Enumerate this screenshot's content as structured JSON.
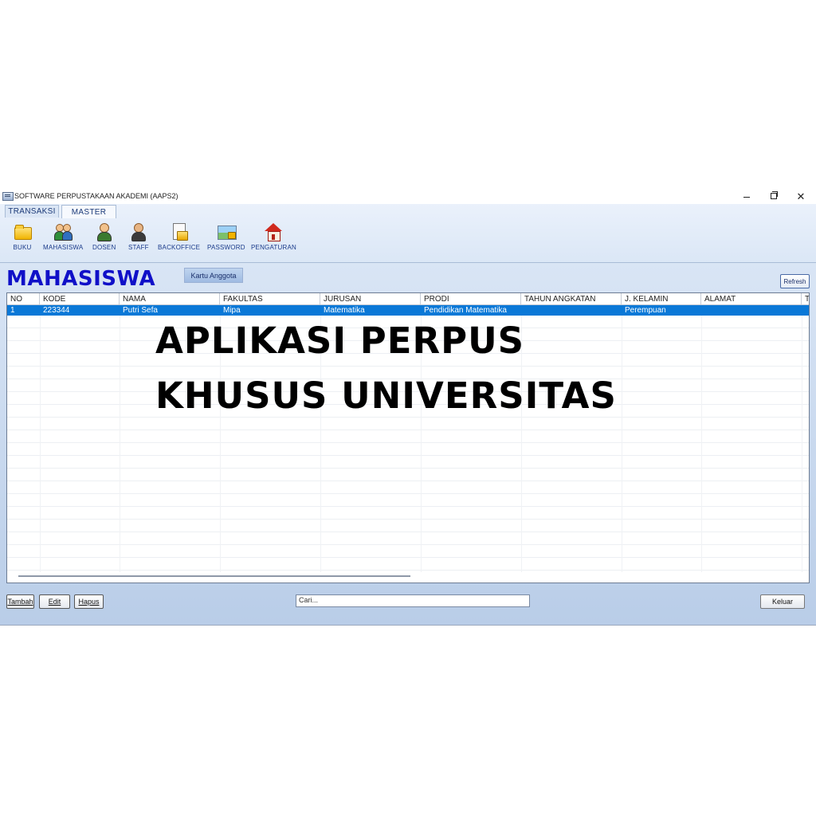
{
  "window": {
    "title": "SOFTWARE PERPUSTAKAAN AKADEMI (AAPS2)"
  },
  "ribbon": {
    "tabs": [
      {
        "label": "TRANSAKSI"
      },
      {
        "label": "MASTER"
      }
    ],
    "tools": [
      {
        "label": "BUKU",
        "icon": "folder-icon"
      },
      {
        "label": "MAHASISWA",
        "icon": "students-icon"
      },
      {
        "label": "DOSEN",
        "icon": "lecturer-icon"
      },
      {
        "label": "STAFF",
        "icon": "staff-icon"
      },
      {
        "label": "BACKOFFICE",
        "icon": "backoffice-icon"
      },
      {
        "label": "PASSWORD",
        "icon": "password-icon"
      },
      {
        "label": "PENGATURAN",
        "icon": "house-icon"
      }
    ]
  },
  "form": {
    "title": "MAHASISWA",
    "kartu_button": "Kartu Anggota",
    "refresh_button": "Refresh"
  },
  "grid": {
    "columns": [
      "NO",
      "KODE",
      "NAMA",
      "FAKULTAS",
      "JURUSAN",
      "PRODI",
      "TAHUN ANGKATAN",
      "J. KELAMIN",
      "ALAMAT",
      "T"
    ],
    "rows": [
      [
        "1",
        "223344",
        "Putri Sefa",
        "Mipa",
        "Matematika",
        "Pendidikan Matematika",
        "",
        "Perempuan",
        ""
      ]
    ]
  },
  "overlay": {
    "line1": "APLIKASI PERPUS",
    "line2": "KHUSUS UNIVERSITAS"
  },
  "footer": {
    "tambah": "Tambah",
    "edit": "Edit",
    "hapus": "Hapus",
    "search_value": "Cari...",
    "keluar": "Keluar"
  },
  "colors": {
    "title_blue": "#1010c8",
    "selection_blue": "#0a78d7"
  }
}
